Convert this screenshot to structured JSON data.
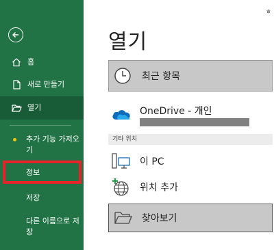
{
  "sidebar": {
    "back_icon": "back-arrow-icon",
    "items": [
      {
        "label": "홈",
        "icon": "home-icon"
      },
      {
        "label": "새로 만들기",
        "icon": "new-doc-icon"
      },
      {
        "label": "열기",
        "icon": "folder-open-icon",
        "active": true
      }
    ],
    "addins_label": "추가 기능 가져오기",
    "info_label": "정보",
    "save_label": "저장",
    "save_as_label": "다른 이름으로 저장"
  },
  "main": {
    "top_glyph": "ㅎ",
    "title": "열기",
    "recent_label": "최근 항목",
    "onedrive_label": "OneDrive - 개인",
    "section_header": "기타 위치",
    "this_pc_label": "이 PC",
    "add_place_label": "위치 추가",
    "browse_label": "찾아보기"
  },
  "colors": {
    "sidebar_bg": "#217346",
    "active_bg": "#185c37",
    "highlight": "#e8222a",
    "selected_tile": "#c8c8c8"
  }
}
